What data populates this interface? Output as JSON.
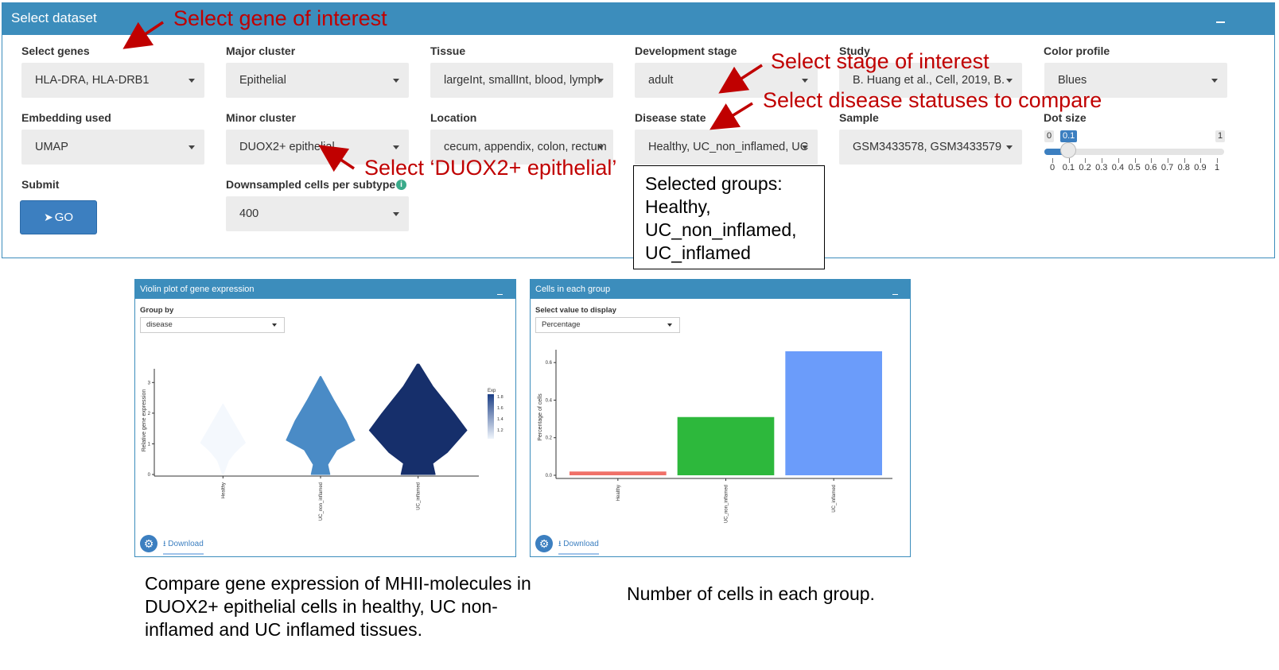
{
  "main_box": {
    "title": "Select dataset",
    "collapse_label": "–"
  },
  "fields": {
    "select_genes": {
      "label": "Select genes",
      "value": "HLA-DRA, HLA-DRB1"
    },
    "major_cluster": {
      "label": "Major cluster",
      "value": "Epithelial"
    },
    "tissue": {
      "label": "Tissue",
      "value": "largeInt, smallInt, blood, lymph"
    },
    "development_stage": {
      "label": "Development stage",
      "value": "adult"
    },
    "study": {
      "label": "Study",
      "value": "B. Huang et al., Cell, 2019, B."
    },
    "color_profile": {
      "label": "Color profile",
      "value": "Blues"
    },
    "embedding_used": {
      "label": "Embedding used",
      "value": "UMAP"
    },
    "minor_cluster": {
      "label": "Minor cluster",
      "value": "DUOX2+ epithelial"
    },
    "location": {
      "label": "Location",
      "value": "cecum, appendix, colon, rectum"
    },
    "disease_state": {
      "label": "Disease state",
      "value": "Healthy, UC_non_inflamed, UC"
    },
    "sample": {
      "label": "Sample",
      "value": "GSM3433578, GSM3433579"
    },
    "dot_size": {
      "label": "Dot size",
      "min_label": "0",
      "max_label": "1",
      "value_label": "0.1",
      "value": 0.1,
      "grid": [
        "0",
        "0.1",
        "0.2",
        "0.3",
        "0.4",
        "0.5",
        "0.6",
        "0.7",
        "0.8",
        "0.9",
        "1"
      ]
    },
    "submit": {
      "label": "Submit",
      "button": "GO"
    },
    "downsampled": {
      "label": "Downsampled cells per subtype",
      "value": "400"
    }
  },
  "annotations": {
    "gene": "Select gene of interest",
    "stage": "Select stage of interest",
    "disease": "Select disease statuses to compare",
    "duox": "Select ‘DUOX2+ epithelial’",
    "groups": [
      "Selected groups:",
      "Healthy,",
      "UC_non_inflamed,",
      "UC_inflamed"
    ]
  },
  "violin_panel": {
    "title": "Violin plot of gene expression",
    "group_label": "Group by",
    "group_value": "disease",
    "download": "Download"
  },
  "bar_panel": {
    "title": "Cells in each group",
    "select_label": "Select value to display",
    "select_value": "Percentage",
    "download": "Download"
  },
  "captions": {
    "left": [
      "Compare gene expression of MHII-molecules in",
      "DUOX2+ epithelial cells in healthy, UC non-",
      "inflamed and UC inflamed tissues."
    ],
    "right": "Number of cells in each group."
  },
  "chart_data": [
    {
      "type": "violin",
      "categories": [
        "Healthy",
        "UC_non_inflamed",
        "UC_inflamed"
      ],
      "ylabel": "Relative gene expression",
      "yticks": [
        "0",
        "1",
        "2",
        "3"
      ],
      "ylim": [
        0,
        3.5
      ],
      "max_values": [
        2.3,
        3.2,
        3.6
      ],
      "mean_expression": [
        1.1,
        1.5,
        1.9
      ],
      "legend_title": "Exp",
      "legend_ticks": [
        "1.8",
        "1.6",
        "1.4",
        "1.2"
      ],
      "colors": [
        "#f4f8fd",
        "#4a8bc6",
        "#162f6b"
      ]
    },
    {
      "type": "bar",
      "categories": [
        "Healthy",
        "UC_non_inflamed",
        "UC_inflamed"
      ],
      "values": [
        0.02,
        0.31,
        0.66
      ],
      "ylabel": "Percentage of cells",
      "yticks": [
        "0.0",
        "0.2",
        "0.4",
        "0.6"
      ],
      "ylim": [
        0,
        0.66
      ],
      "colors": [
        "#f07068",
        "#2db83c",
        "#6b9cfa"
      ]
    }
  ]
}
